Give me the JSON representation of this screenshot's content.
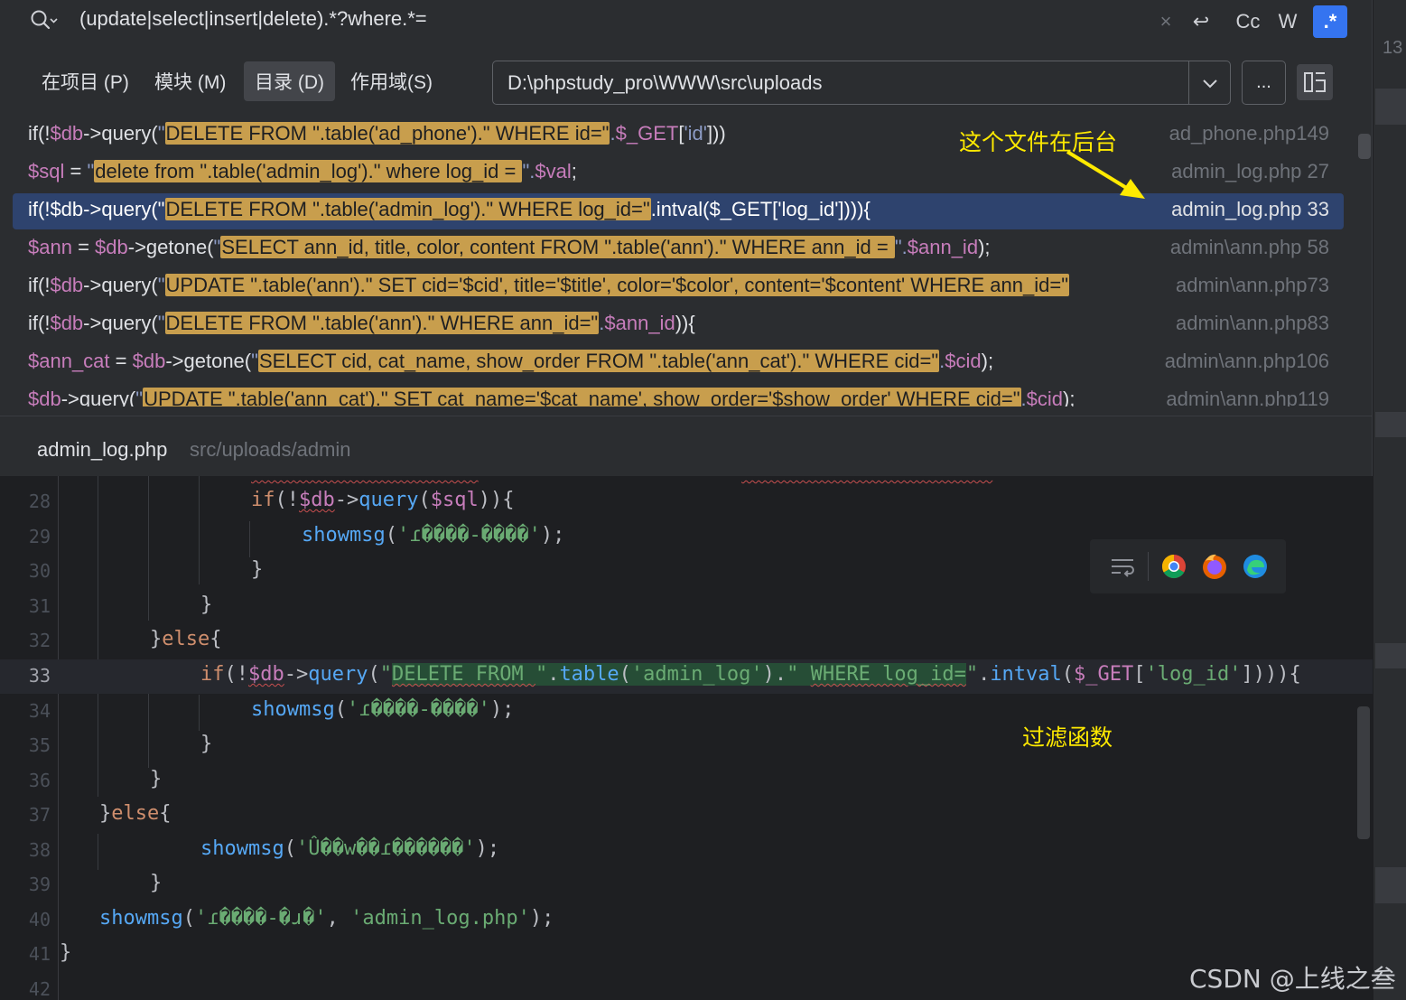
{
  "search": {
    "query": "(update|select|insert|delete).*?where.*=",
    "clear_icon": "×",
    "newline_icon": "↩",
    "case_label": "Cc",
    "word_label": "W",
    "regex_label": ".*"
  },
  "scope": {
    "tabs": [
      {
        "label": "在项目 (P)"
      },
      {
        "label": "模块 (M)"
      },
      {
        "label": "目录 (D)"
      },
      {
        "label": "作用域(S)"
      }
    ],
    "active_tab": "目录 (D)",
    "directory": "D:\\phpstudy_pro\\WWW\\src\\uploads",
    "browse_label": "..."
  },
  "results": [
    {
      "file": "ad_phone.php149"
    },
    {
      "file": "admin_log.php 27"
    },
    {
      "file": "admin_log.php 33"
    },
    {
      "file": "admin\\ann.php 58"
    },
    {
      "file": "admin\\ann.php73"
    },
    {
      "file": "admin\\ann.php83"
    },
    {
      "file": "admin\\ann.php106"
    },
    {
      "file": "admin\\ann.php119"
    }
  ],
  "preview": {
    "filename": "admin_log.php",
    "path": "src/uploads/admin"
  },
  "editor": {
    "line_numbers": [
      "28",
      "29",
      "30",
      "31",
      "32",
      "33",
      "34",
      "35",
      "36",
      "37",
      "38",
      "39",
      "40",
      "41",
      "42"
    ],
    "current_line": "33"
  },
  "sidebar": {
    "text": "13"
  },
  "annotations": {
    "backend_note": "这个文件在后台",
    "filter_note": "过滤函数"
  },
  "watermark": "CSDN @上线之叁",
  "colors": {
    "background": "#1e1f22",
    "popup": "#2b2d30",
    "selection": "#2e436e",
    "match_highlight": "#c89e4d",
    "regex_active": "#3574f0",
    "annotation": "#ffea00"
  },
  "icons": [
    "search-icon",
    "clear-icon",
    "newline-icon",
    "chevron-down-icon",
    "split-view-icon",
    "soft-wrap-icon",
    "chrome-icon",
    "firefox-icon",
    "edge-icon",
    "arrow-annotation"
  ]
}
